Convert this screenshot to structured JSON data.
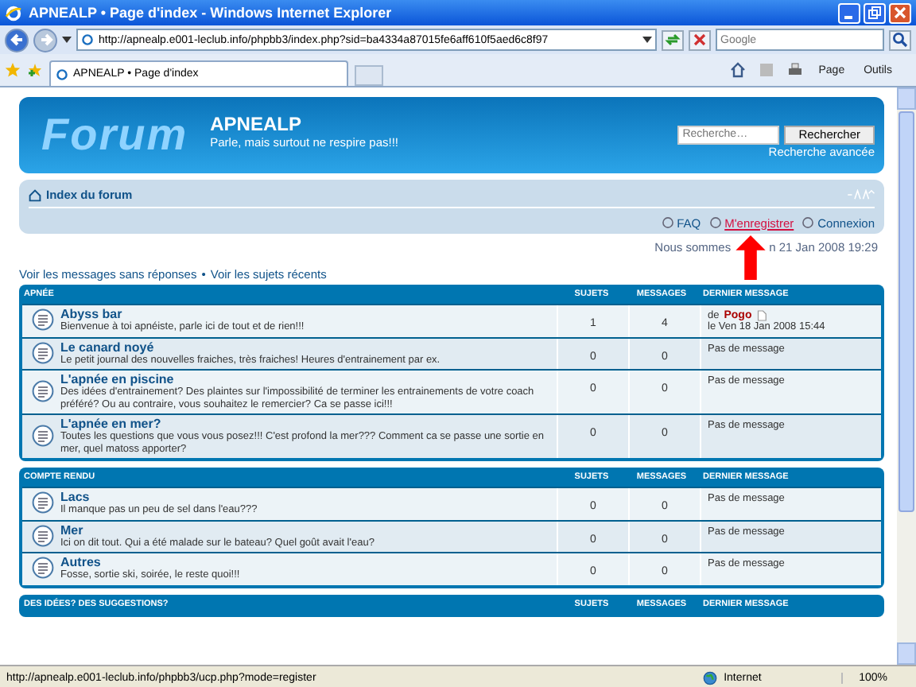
{
  "window": {
    "title": "APNEALP • Page d'index - Windows Internet Explorer"
  },
  "address_bar": {
    "url": "http://apnealp.e001-leclub.info/phpbb3/index.php?sid=ba4334a87015fe6aff610f5aed6c8f97",
    "search_placeholder": "Google"
  },
  "tab": {
    "label": "APNEALP • Page d'index"
  },
  "command_bar": {
    "page": "Page",
    "tools": "Outils"
  },
  "header": {
    "logo": "Forum",
    "site_name": "APNEALP",
    "tagline": "Parle, mais surtout ne respire pas!!!",
    "search_placeholder": "Recherche…",
    "search_button": "Rechercher",
    "advanced_search": "Recherche avancée"
  },
  "navbar": {
    "breadcrumb": "Index du forum",
    "links": [
      {
        "label": "FAQ",
        "hovered": false
      },
      {
        "label": "M'enregistrer",
        "hovered": true
      },
      {
        "label": "Connexion",
        "hovered": false
      }
    ]
  },
  "date_visible_before": "Nous sommes",
  "date_visible_after": "n 21 Jan 2008 19:29",
  "quick_links": [
    "Voir les messages sans réponses",
    "Voir les sujets récents"
  ],
  "quick_links_separator": "•",
  "categories": [
    {
      "name": "APNÉE",
      "columns": [
        "SUJETS",
        "MESSAGES",
        "DERNIER MESSAGE"
      ],
      "forums": [
        {
          "title": "Abyss bar",
          "description": "Bienvenue à toi apnéiste, parle ici de tout et de rien!!!",
          "topics": "1",
          "posts": "4",
          "last_post": {
            "prefix": "de",
            "author": "Pogo",
            "date": "le Ven 18 Jan 2008 15:44"
          }
        },
        {
          "title": "Le canard noyé",
          "description": "Le petit journal des nouvelles fraiches, très fraiches! Heures d'entrainement par ex.",
          "topics": "0",
          "posts": "0",
          "no_post": "Pas de message"
        },
        {
          "title": "L'apnée en piscine",
          "description": "Des idées d'entrainement? Des plaintes sur l'impossibilité de terminer les entrainements de votre coach préféré? Ou au contraire, vous souhaitez le remercier? Ca se passe ici!!!",
          "topics": "0",
          "posts": "0",
          "no_post": "Pas de message"
        },
        {
          "title": "L'apnée en mer?",
          "description": "Toutes les questions que vous vous posez!!! C'est profond la mer??? Comment ca se passe une sortie en mer, quel matoss apporter?",
          "topics": "0",
          "posts": "0",
          "no_post": "Pas de message"
        }
      ]
    },
    {
      "name": "COMPTE RENDU",
      "columns": [
        "SUJETS",
        "MESSAGES",
        "DERNIER MESSAGE"
      ],
      "forums": [
        {
          "title": "Lacs",
          "description": "Il manque pas un peu de sel dans l'eau???",
          "topics": "0",
          "posts": "0",
          "no_post": "Pas de message"
        },
        {
          "title": "Mer",
          "description": "Ici on dit tout. Qui a été malade sur le bateau? Quel goût avait l'eau?",
          "topics": "0",
          "posts": "0",
          "no_post": "Pas de message"
        },
        {
          "title": "Autres",
          "description": "Fosse, sortie ski, soirée, le reste quoi!!!",
          "topics": "0",
          "posts": "0",
          "no_post": "Pas de message"
        }
      ]
    },
    {
      "name": "DES IDÉES? DES SUGGESTIONS?",
      "columns": [
        "SUJETS",
        "MESSAGES",
        "DERNIER MESSAGE"
      ]
    }
  ],
  "status_bar": {
    "url": "http://apnealp.e001-leclub.info/phpbb3/ucp.php?mode=register",
    "zone": "Internet",
    "zoom": "100%"
  }
}
